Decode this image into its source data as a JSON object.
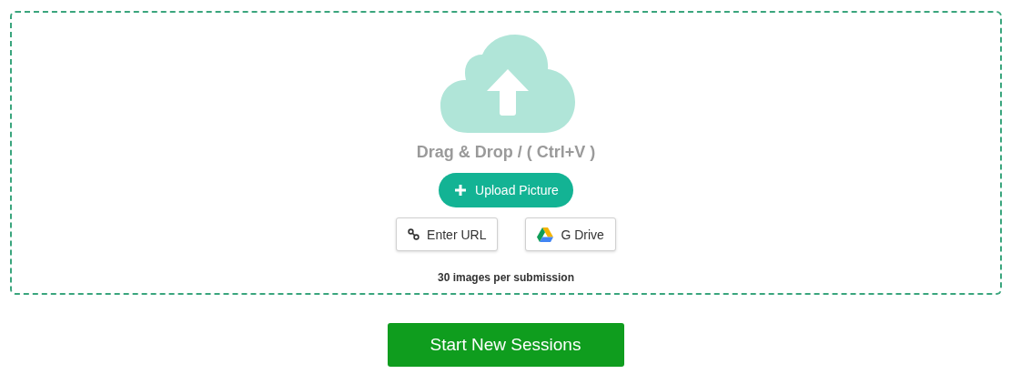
{
  "dropzone": {
    "prompt": "Drag & Drop / ( Ctrl+V )",
    "upload_button": "Upload Picture",
    "sources": [
      {
        "kind": "url",
        "label": "Enter URL"
      },
      {
        "kind": "drive",
        "label": "G Drive"
      }
    ],
    "limit_note": "30 images per submission"
  },
  "start_button": "Start New Sessions"
}
